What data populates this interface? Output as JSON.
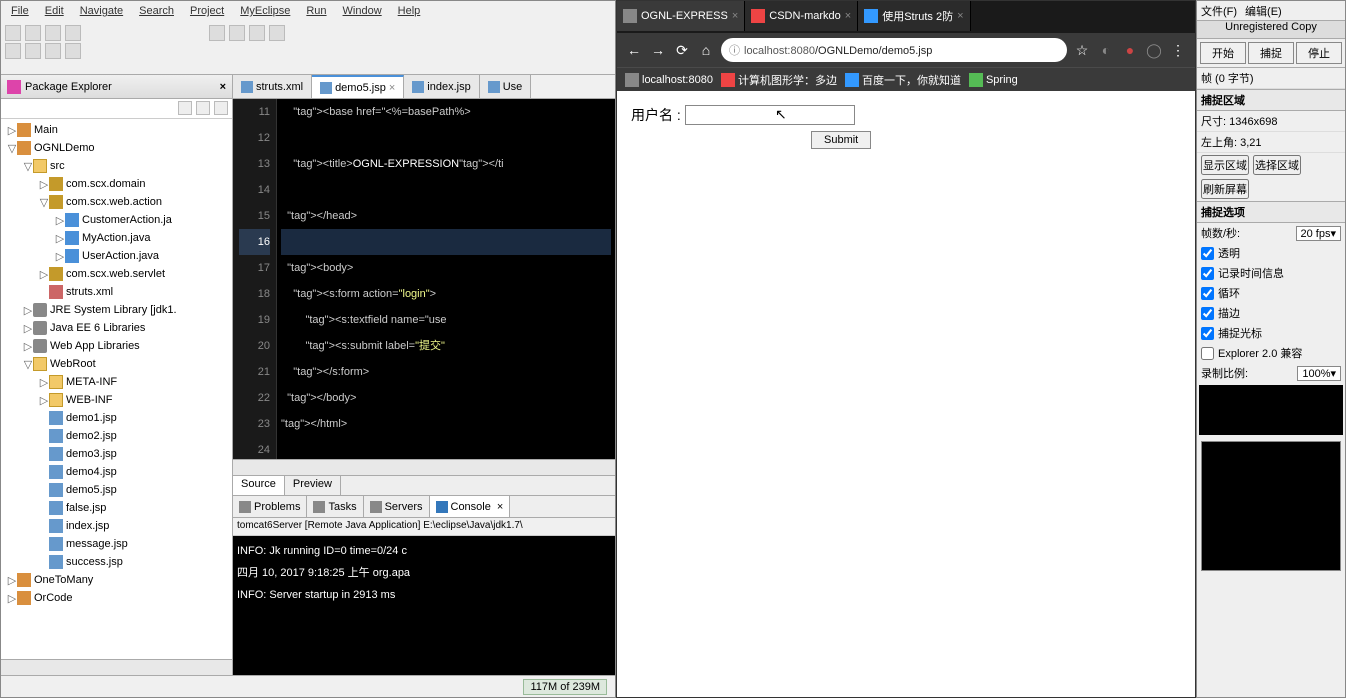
{
  "ide": {
    "menu": [
      "File",
      "Edit",
      "Navigate",
      "Search",
      "Project",
      "MyEclipse",
      "Run",
      "Window",
      "Help"
    ],
    "pkg_explorer": {
      "title": "Package Explorer",
      "tree": [
        {
          "lvl": 0,
          "icon": "prj",
          "label": "Main",
          "arrow": "▷"
        },
        {
          "lvl": 0,
          "icon": "prj",
          "label": "OGNLDemo",
          "arrow": "▽"
        },
        {
          "lvl": 1,
          "icon": "folder",
          "label": "src",
          "arrow": "▽"
        },
        {
          "lvl": 2,
          "icon": "pkg",
          "label": "com.scx.domain",
          "arrow": "▷"
        },
        {
          "lvl": 2,
          "icon": "pkg",
          "label": "com.scx.web.action",
          "arrow": "▽"
        },
        {
          "lvl": 3,
          "icon": "java",
          "label": "CustomerAction.ja",
          "arrow": "▷"
        },
        {
          "lvl": 3,
          "icon": "java",
          "label": "MyAction.java",
          "arrow": "▷"
        },
        {
          "lvl": 3,
          "icon": "java",
          "label": "UserAction.java",
          "arrow": "▷"
        },
        {
          "lvl": 2,
          "icon": "pkg",
          "label": "com.scx.web.servlet",
          "arrow": "▷"
        },
        {
          "lvl": 2,
          "icon": "xml",
          "label": "struts.xml",
          "arrow": ""
        },
        {
          "lvl": 1,
          "icon": "lib",
          "label": "JRE System Library [jdk1.",
          "arrow": "▷"
        },
        {
          "lvl": 1,
          "icon": "lib",
          "label": "Java EE 6 Libraries",
          "arrow": "▷"
        },
        {
          "lvl": 1,
          "icon": "lib",
          "label": "Web App Libraries",
          "arrow": "▷"
        },
        {
          "lvl": 1,
          "icon": "folder",
          "label": "WebRoot",
          "arrow": "▽"
        },
        {
          "lvl": 2,
          "icon": "folder",
          "label": "META-INF",
          "arrow": "▷"
        },
        {
          "lvl": 2,
          "icon": "folder",
          "label": "WEB-INF",
          "arrow": "▷"
        },
        {
          "lvl": 2,
          "icon": "jsp",
          "label": "demo1.jsp",
          "arrow": ""
        },
        {
          "lvl": 2,
          "icon": "jsp",
          "label": "demo2.jsp",
          "arrow": ""
        },
        {
          "lvl": 2,
          "icon": "jsp",
          "label": "demo3.jsp",
          "arrow": ""
        },
        {
          "lvl": 2,
          "icon": "jsp",
          "label": "demo4.jsp",
          "arrow": ""
        },
        {
          "lvl": 2,
          "icon": "jsp",
          "label": "demo5.jsp",
          "arrow": ""
        },
        {
          "lvl": 2,
          "icon": "jsp",
          "label": "false.jsp",
          "arrow": ""
        },
        {
          "lvl": 2,
          "icon": "jsp",
          "label": "index.jsp",
          "arrow": ""
        },
        {
          "lvl": 2,
          "icon": "jsp",
          "label": "message.jsp",
          "arrow": ""
        },
        {
          "lvl": 2,
          "icon": "jsp",
          "label": "success.jsp",
          "arrow": ""
        },
        {
          "lvl": 0,
          "icon": "prj",
          "label": "OneToMany",
          "arrow": "▷"
        },
        {
          "lvl": 0,
          "icon": "prj",
          "label": "OrCode",
          "arrow": "▷"
        }
      ]
    },
    "editor_tabs": [
      {
        "label": "struts.xml",
        "icon": "xml"
      },
      {
        "label": "demo5.jsp",
        "icon": "jsp",
        "active": true
      },
      {
        "label": "index.jsp",
        "icon": "jsp"
      },
      {
        "label": "Use",
        "icon": "java"
      }
    ],
    "code_lines": [
      {
        "n": 11,
        "txt": "    <base href=\"<%=basePath%>"
      },
      {
        "n": 12,
        "txt": ""
      },
      {
        "n": 13,
        "txt": "    <title>OGNL-EXPRESSION</ti"
      },
      {
        "n": 14,
        "txt": ""
      },
      {
        "n": 15,
        "txt": "  </head>"
      },
      {
        "n": 16,
        "txt": "",
        "hl": true
      },
      {
        "n": 17,
        "txt": "  <body>"
      },
      {
        "n": 18,
        "txt": "    <s:form action=\"login\">"
      },
      {
        "n": 19,
        "txt": "        <s:textfield name=\"use"
      },
      {
        "n": 20,
        "txt": "        <s:submit label=\"提交\""
      },
      {
        "n": 21,
        "txt": "    </s:form>"
      },
      {
        "n": 22,
        "txt": "  </body>"
      },
      {
        "n": 23,
        "txt": "</html>"
      },
      {
        "n": 24,
        "txt": ""
      }
    ],
    "bottom_tabs": [
      "Source",
      "Preview"
    ],
    "console": {
      "tabs": [
        "Problems",
        "Tasks",
        "Servers",
        "Console"
      ],
      "header": "tomcat6Server [Remote Java Application] E:\\eclipse\\Java\\jdk1.7\\",
      "lines": [
        "INFO: Jk running ID=0 time=0/24  c",
        "四月 10, 2017 9:18:25 上午 org.apa",
        "INFO: Server startup in 2913 ms"
      ]
    },
    "status": {
      "memory": "117M of 239M"
    }
  },
  "browser": {
    "tabs": [
      {
        "label": "OGNL-EXPRESS",
        "active": true,
        "color": "#888"
      },
      {
        "label": "CSDN-markdo",
        "color": "#e44"
      },
      {
        "label": "使用Struts 2防",
        "color": "#39f"
      }
    ],
    "nav": {
      "info_icon": "ⓘ",
      "star": "☆",
      "menu": "⋮"
    },
    "url": {
      "host": "localhost:8080",
      "path": "/OGNLDemo/demo5.jsp"
    },
    "bookmarks": [
      {
        "label": "localhost:8080",
        "color": "#888"
      },
      {
        "label": "计算机图形学：多边",
        "color": "#e44"
      },
      {
        "label": "百度一下，你就知道",
        "color": "#39f"
      },
      {
        "label": "Spring",
        "color": "#5b5"
      }
    ],
    "form": {
      "label": "用户名 :",
      "submit": "Submit"
    }
  },
  "capture": {
    "menu": [
      "文件(F)",
      "编辑(E)"
    ],
    "title": "Unregistered Copy",
    "buttons": [
      "开始",
      "捕捉",
      "停止"
    ],
    "status": "帧 (0 字节)",
    "region_header": "捕捉区域",
    "dimensions": "尺寸:  1346x698",
    "corner": "左上角:  3,21",
    "btn_show": "显示区域",
    "btn_select": "选择区域",
    "btn_refresh": "刷新屏幕",
    "options_header": "捕捉选项",
    "fps_label": "帧数/秒:",
    "fps_value": "20 fps▾",
    "opt_transparent": "透明",
    "opt_time": "记录时间信息",
    "opt_loop": "循环",
    "opt_border": "描边",
    "opt_cursor": "捕捉光标",
    "opt_compat": "Explorer 2.0 兼容",
    "ratio_label": "录制比例:",
    "ratio_value": "100%▾"
  }
}
